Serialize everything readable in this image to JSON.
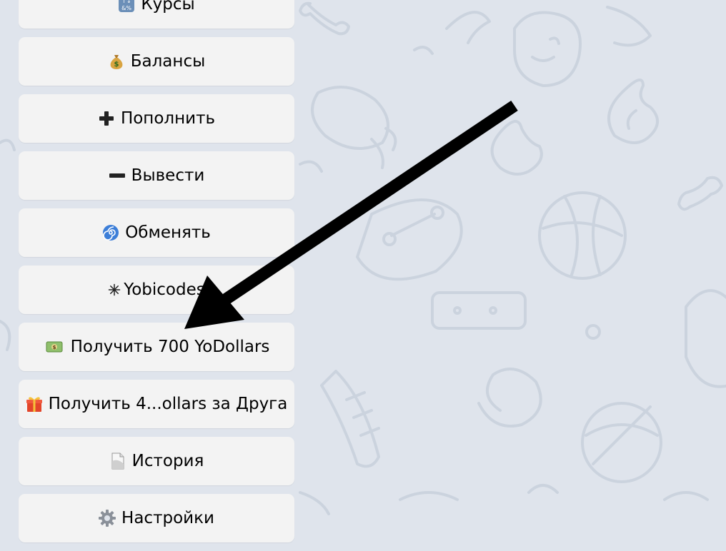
{
  "keyboard": {
    "buttons": [
      {
        "icon": "input-symbols-icon",
        "label": "Курсы"
      },
      {
        "icon": "money-bag-icon",
        "label": "Балансы"
      },
      {
        "icon": "plus-icon",
        "label": "Пополнить"
      },
      {
        "icon": "minus-icon",
        "label": "Вывести"
      },
      {
        "icon": "cyclone-icon",
        "label": "Обменять"
      },
      {
        "icon": "asterisk-icon",
        "label": "Yobicodes"
      },
      {
        "icon": "dollar-banknote-icon",
        "label": "Получить 700 YoDollars"
      },
      {
        "icon": "gift-icon",
        "label": "Получить 4...ollars за Друга"
      },
      {
        "icon": "page-icon",
        "label": "История"
      },
      {
        "icon": "gear-icon",
        "label": "Настройки"
      }
    ]
  },
  "annotation": {
    "type": "arrow",
    "color": "#000000",
    "points_to": "Получить 700 YoDollars"
  },
  "colors": {
    "chat_background": "#dfe4ec",
    "pattern": "#cbd3de",
    "button_background": "#f3f3f3",
    "text": "#000000"
  }
}
